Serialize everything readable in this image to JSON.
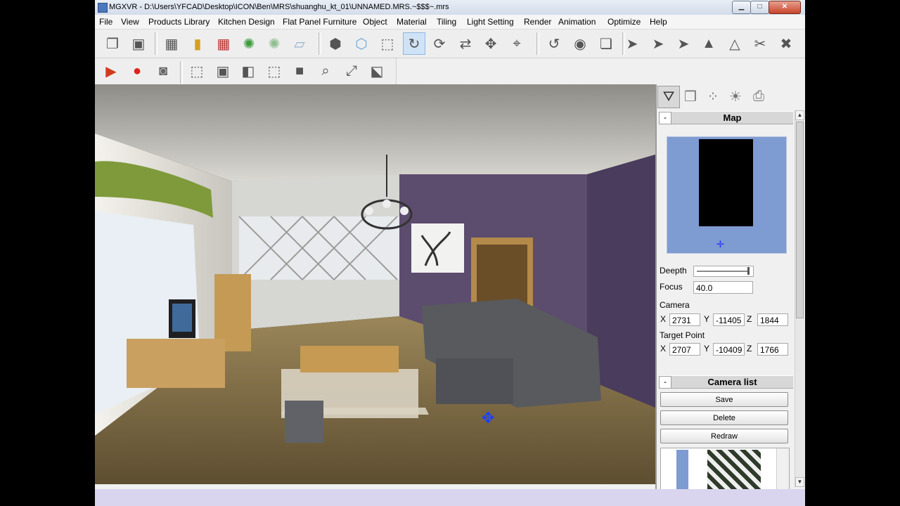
{
  "window": {
    "title": "MGXVR - D:\\Users\\YFCAD\\Desktop\\ICON\\Ben\\MRS\\shuanghu_kt_01\\UNNAMED.MRS.~$$$~.mrs",
    "minimize_glyph": "▁",
    "maximize_glyph": "□",
    "close_glyph": "✕"
  },
  "menu": {
    "items": [
      "File",
      "View",
      "Products Library",
      "Kitchen Design",
      "Flat Panel Furniture",
      "Object",
      "Material",
      "Tiling",
      "Light Setting",
      "Render",
      "Animation",
      "Optimize",
      "Help"
    ]
  },
  "toolbar1": {
    "icons": [
      "copy-object",
      "group",
      "delete-grid",
      "bars",
      "delete-list",
      "light-burst",
      "light-spot",
      "floor-plane",
      "box-3d",
      "box-3d-filled",
      "wire-box",
      "rotate",
      "orbit",
      "refresh",
      "move",
      "target",
      "undo-rotate",
      "eye",
      "files",
      "select-arrow",
      "select-arrow-2",
      "select-arrow-3",
      "pyramid",
      "triangle",
      "cut-tool",
      "delete-select"
    ],
    "glyphs": [
      "❐",
      "▣",
      "▦",
      "▮",
      "▦",
      "✺",
      "✺",
      "▱",
      "⬢",
      "⬡",
      "⬚",
      "↻",
      "⟳",
      "⇄",
      "✥",
      "⌖",
      "↺",
      "◉",
      "❏",
      "➤",
      "➤",
      "➤",
      "▲",
      "△",
      "✂",
      "✖"
    ]
  },
  "toolbar2": {
    "icons": [
      "play",
      "record",
      "camera",
      "view-top",
      "view-front",
      "view-side",
      "view-perspective",
      "view-solid",
      "zoom",
      "fit-view",
      "camera-view"
    ],
    "glyphs": [
      "▶",
      "●",
      "◙",
      "⬚",
      "▣",
      "◧",
      "⬚",
      "■",
      "⌕",
      "⤢",
      "⬕"
    ],
    "colors": [
      "#d03a1c",
      "#e0201a",
      "#666666",
      "#444444",
      "#444444",
      "#444444",
      "#444444",
      "#444444",
      "#444444",
      "#444444",
      "#444444"
    ]
  },
  "panel": {
    "tabs": [
      "camera-settings",
      "object",
      "materials",
      "light",
      "render-settings"
    ],
    "tab_glyphs": [
      "⛛",
      "❒",
      "⁘",
      "☀",
      "⎙"
    ],
    "map_section": {
      "title": "Map",
      "collapse": "-"
    },
    "depth_label": "Deepth",
    "focus_label": "Focus",
    "focus_value": "40.0",
    "camera_label": "Camera",
    "camera": {
      "x": "2731",
      "y": "-11405",
      "z": "1844"
    },
    "target_label": "Target Point",
    "target": {
      "x": "2707",
      "y": "-10409",
      "z": "1766"
    },
    "axis_labels": {
      "x": "X",
      "y": "Y",
      "z": "Z"
    },
    "camera_list_section": {
      "title": "Camera list",
      "collapse": "-"
    },
    "buttons": {
      "save": "Save",
      "delete": "Delete",
      "redraw": "Redraw"
    }
  },
  "map_marker_glyph": "✛",
  "viewport_marker_glyph": "✥",
  "scroll": {
    "up": "▲",
    "down": "▼"
  }
}
